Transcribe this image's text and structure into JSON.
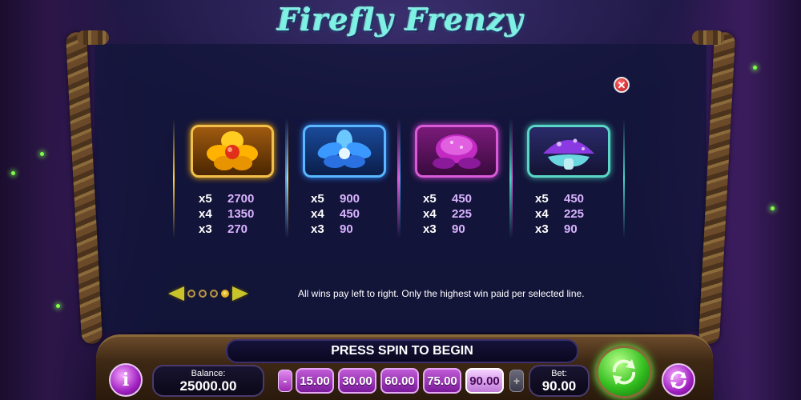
{
  "game": {
    "title": "Firefly Frenzy"
  },
  "paytable": {
    "close_icon": "close-icon",
    "symbols": [
      {
        "name": "golden-flower-symbol",
        "color": "#f2c04a",
        "pays": [
          {
            "mult": "x5",
            "value": "2700"
          },
          {
            "mult": "x4",
            "value": "1350"
          },
          {
            "mult": "x3",
            "value": "270"
          }
        ]
      },
      {
        "name": "blue-lotus-symbol",
        "color": "#59b6ff",
        "pays": [
          {
            "mult": "x5",
            "value": "900"
          },
          {
            "mult": "x4",
            "value": "450"
          },
          {
            "mult": "x3",
            "value": "90"
          }
        ]
      },
      {
        "name": "pink-bud-symbol",
        "color": "#d85ad8",
        "pays": [
          {
            "mult": "x5",
            "value": "450"
          },
          {
            "mult": "x4",
            "value": "225"
          },
          {
            "mult": "x3",
            "value": "90"
          }
        ]
      },
      {
        "name": "purple-mushroom-symbol",
        "color": "#5ad6c6",
        "pays": [
          {
            "mult": "x5",
            "value": "450"
          },
          {
            "mult": "x4",
            "value": "225"
          },
          {
            "mult": "x3",
            "value": "90"
          }
        ]
      }
    ],
    "info_text": "All wins pay left to right. Only the highest win paid per selected line.",
    "pager": {
      "pages": 4,
      "active_index": 3
    }
  },
  "controls": {
    "message": "PRESS SPIN TO BEGIN",
    "info_button_label": "i",
    "balance_label": "Balance:",
    "balance_value": "25000.00",
    "bet_minus_label": "-",
    "bet_plus_label": "+",
    "bet_options": [
      "15.00",
      "30.00",
      "60.00",
      "75.00",
      "90.00"
    ],
    "selected_bet_index": 4,
    "bet_label": "Bet:",
    "bet_value": "90.00"
  }
}
